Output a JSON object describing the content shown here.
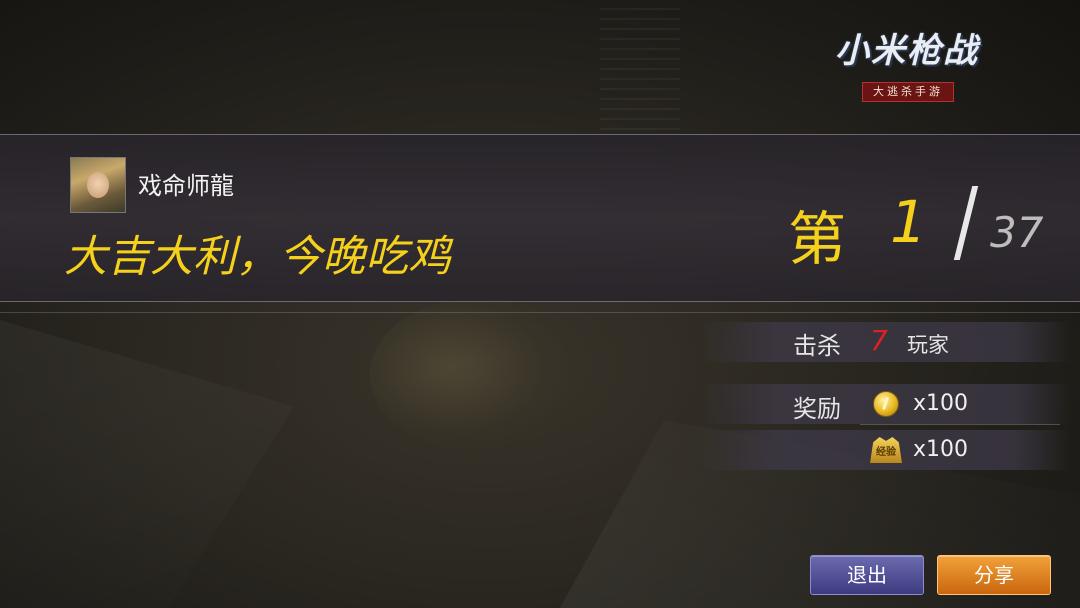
{
  "logo": {
    "title": "小米枪战",
    "subtitle": "大逃杀手游"
  },
  "player": {
    "name": "戏命师龍",
    "avatar": "player-avatar"
  },
  "result": {
    "slogan": "大吉大利，今晚吃鸡",
    "rank_prefix": "第",
    "rank": "1",
    "total": "37"
  },
  "stats": {
    "kills_label": "击杀",
    "kills_value": "7",
    "kills_unit": "玩家",
    "reward_label": "奖励",
    "rewards": [
      {
        "icon": "gold-coin-icon",
        "amount": "x100"
      },
      {
        "icon": "experience-badge-icon",
        "badge_text": "经验",
        "amount": "x100"
      }
    ]
  },
  "buttons": {
    "exit": "退出",
    "share": "分享"
  },
  "colors": {
    "accent_yellow": "#f5d11c",
    "kill_red": "#e02020",
    "exit_purple": "#4b4890",
    "share_orange": "#e0841f"
  }
}
